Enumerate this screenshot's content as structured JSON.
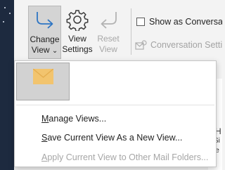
{
  "ribbon": {
    "change_view": {
      "line1": "Change",
      "line2": "View",
      "caret": "⌄"
    },
    "view_settings": {
      "line1": "View",
      "line2": "Settings"
    },
    "reset_view": {
      "line1": "Reset",
      "line2": "View"
    },
    "show_as_conversations": {
      "label": "Show as Conversations",
      "checked": false
    },
    "conversation_settings": {
      "label": "Conversation Settings",
      "caret": "⌄"
    }
  },
  "dropdown": {
    "items": [
      {
        "accel": "M",
        "rest": "anage Views...",
        "enabled": true
      },
      {
        "accel": "S",
        "rest": "ave Current View As a New View...",
        "enabled": true
      },
      {
        "accel": "A",
        "rest": "pply Current View to Other Mail Folders...",
        "enabled": false
      }
    ]
  },
  "background_fragments": [
    "s",
    "H",
    "Si",
    "le"
  ],
  "colors": {
    "ribbon_bg": "#f3f3f3",
    "selected_button_bg": "#d4d4d4",
    "accent_blue": "#2e75c3",
    "envelope": "#f2c46e",
    "disabled_text": "#a6a6a6",
    "window_left_strip": "#1d2a3f"
  }
}
